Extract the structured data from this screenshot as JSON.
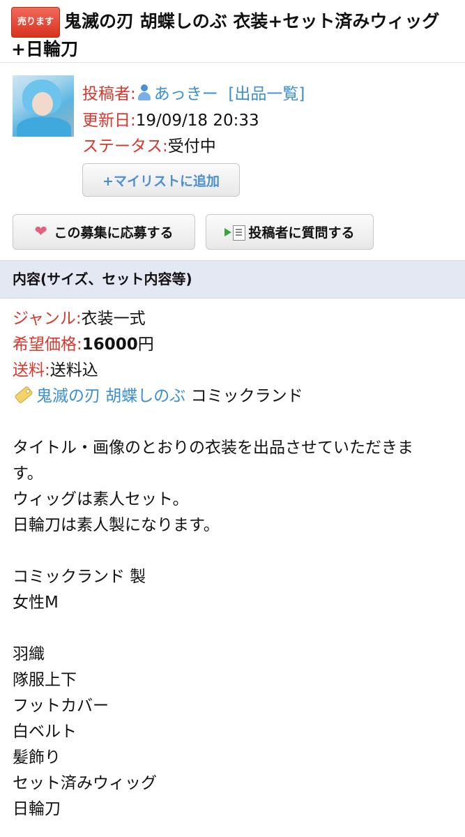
{
  "header": {
    "badge": "売ります",
    "title": "鬼滅の刃 胡蝶しのぶ 衣装+セット済みウィッグ+日輪刀"
  },
  "poster": {
    "poster_label": "投稿者:",
    "poster_name": "あっきー",
    "listing_link": "[出品一覧]",
    "updated_label": "更新日:",
    "updated_value": "19/09/18 20:33",
    "status_label": "ステータス:",
    "status_value": "受付中",
    "mylist_button": "+マイリストに追加"
  },
  "actions": {
    "apply_button": "この募集に応募する",
    "ask_button": "投稿者に質問する"
  },
  "section": {
    "heading": "内容(サイズ、セット内容等)"
  },
  "details": {
    "genre_label": "ジャンル:",
    "genre_value": "衣装一式",
    "price_label": "希望価格:",
    "price_value": "16000",
    "price_unit": "円",
    "shipping_label": "送料:",
    "shipping_value": "送料込",
    "tag_links": "鬼滅の刃 胡蝶しのぶ",
    "tag_maker": "コミックランド"
  },
  "description": {
    "lines": [
      "",
      "タイトル・画像のとおりの衣装を出品させていただきま",
      "す。",
      "ウィッグは素人セット。",
      "日輪刀は素人製になります。",
      "",
      "コミックランド 製",
      "女性M",
      "",
      "羽織",
      "隊服上下",
      "フットカバー",
      "白ベルト",
      "髪飾り",
      "セット済みウィッグ",
      "日輪刀"
    ]
  },
  "colors": {
    "accent_red": "#d8372c",
    "link_blue": "#3b8ed0",
    "section_bg": "#e3e8f3"
  }
}
